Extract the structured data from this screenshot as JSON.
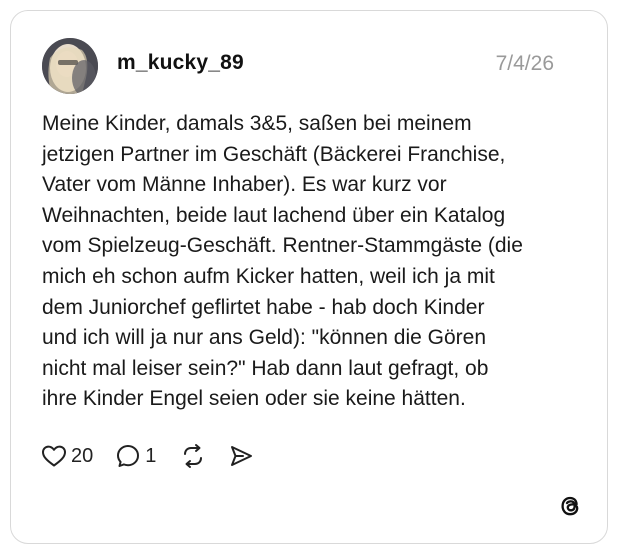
{
  "post": {
    "username": "m_kucky_89",
    "date": "7/4/26",
    "text_lines": [
      "Meine Kinder, damals 3&5, saßen bei meinem",
      "jetzigen Partner im Geschäft (Bäckerei Franchise,",
      "Vater vom Männe Inhaber). Es war kurz vor",
      "Weihnachten, beide laut lachend über ein Katalog",
      "vom Spielzeug-Geschäft. Rentner-Stammgäste (die",
      "mich eh schon aufm Kicker hatten, weil ich ja mit",
      "dem Juniorchef geflirtet habe - hab doch Kinder",
      "und ich will ja nur ans Geld): \"können die Gören",
      "nicht mal leiser sein?\" Hab dann laut gefragt, ob",
      "ihre Kinder Engel seien oder sie keine hätten."
    ]
  },
  "actions": {
    "like_count": "20",
    "reply_count": "1",
    "like_icon": "heart-icon",
    "reply_icon": "comment-bubble-icon",
    "repost_icon": "repost-icon",
    "share_icon": "send-icon"
  },
  "branding": {
    "logo_icon": "threads-logo-icon"
  }
}
